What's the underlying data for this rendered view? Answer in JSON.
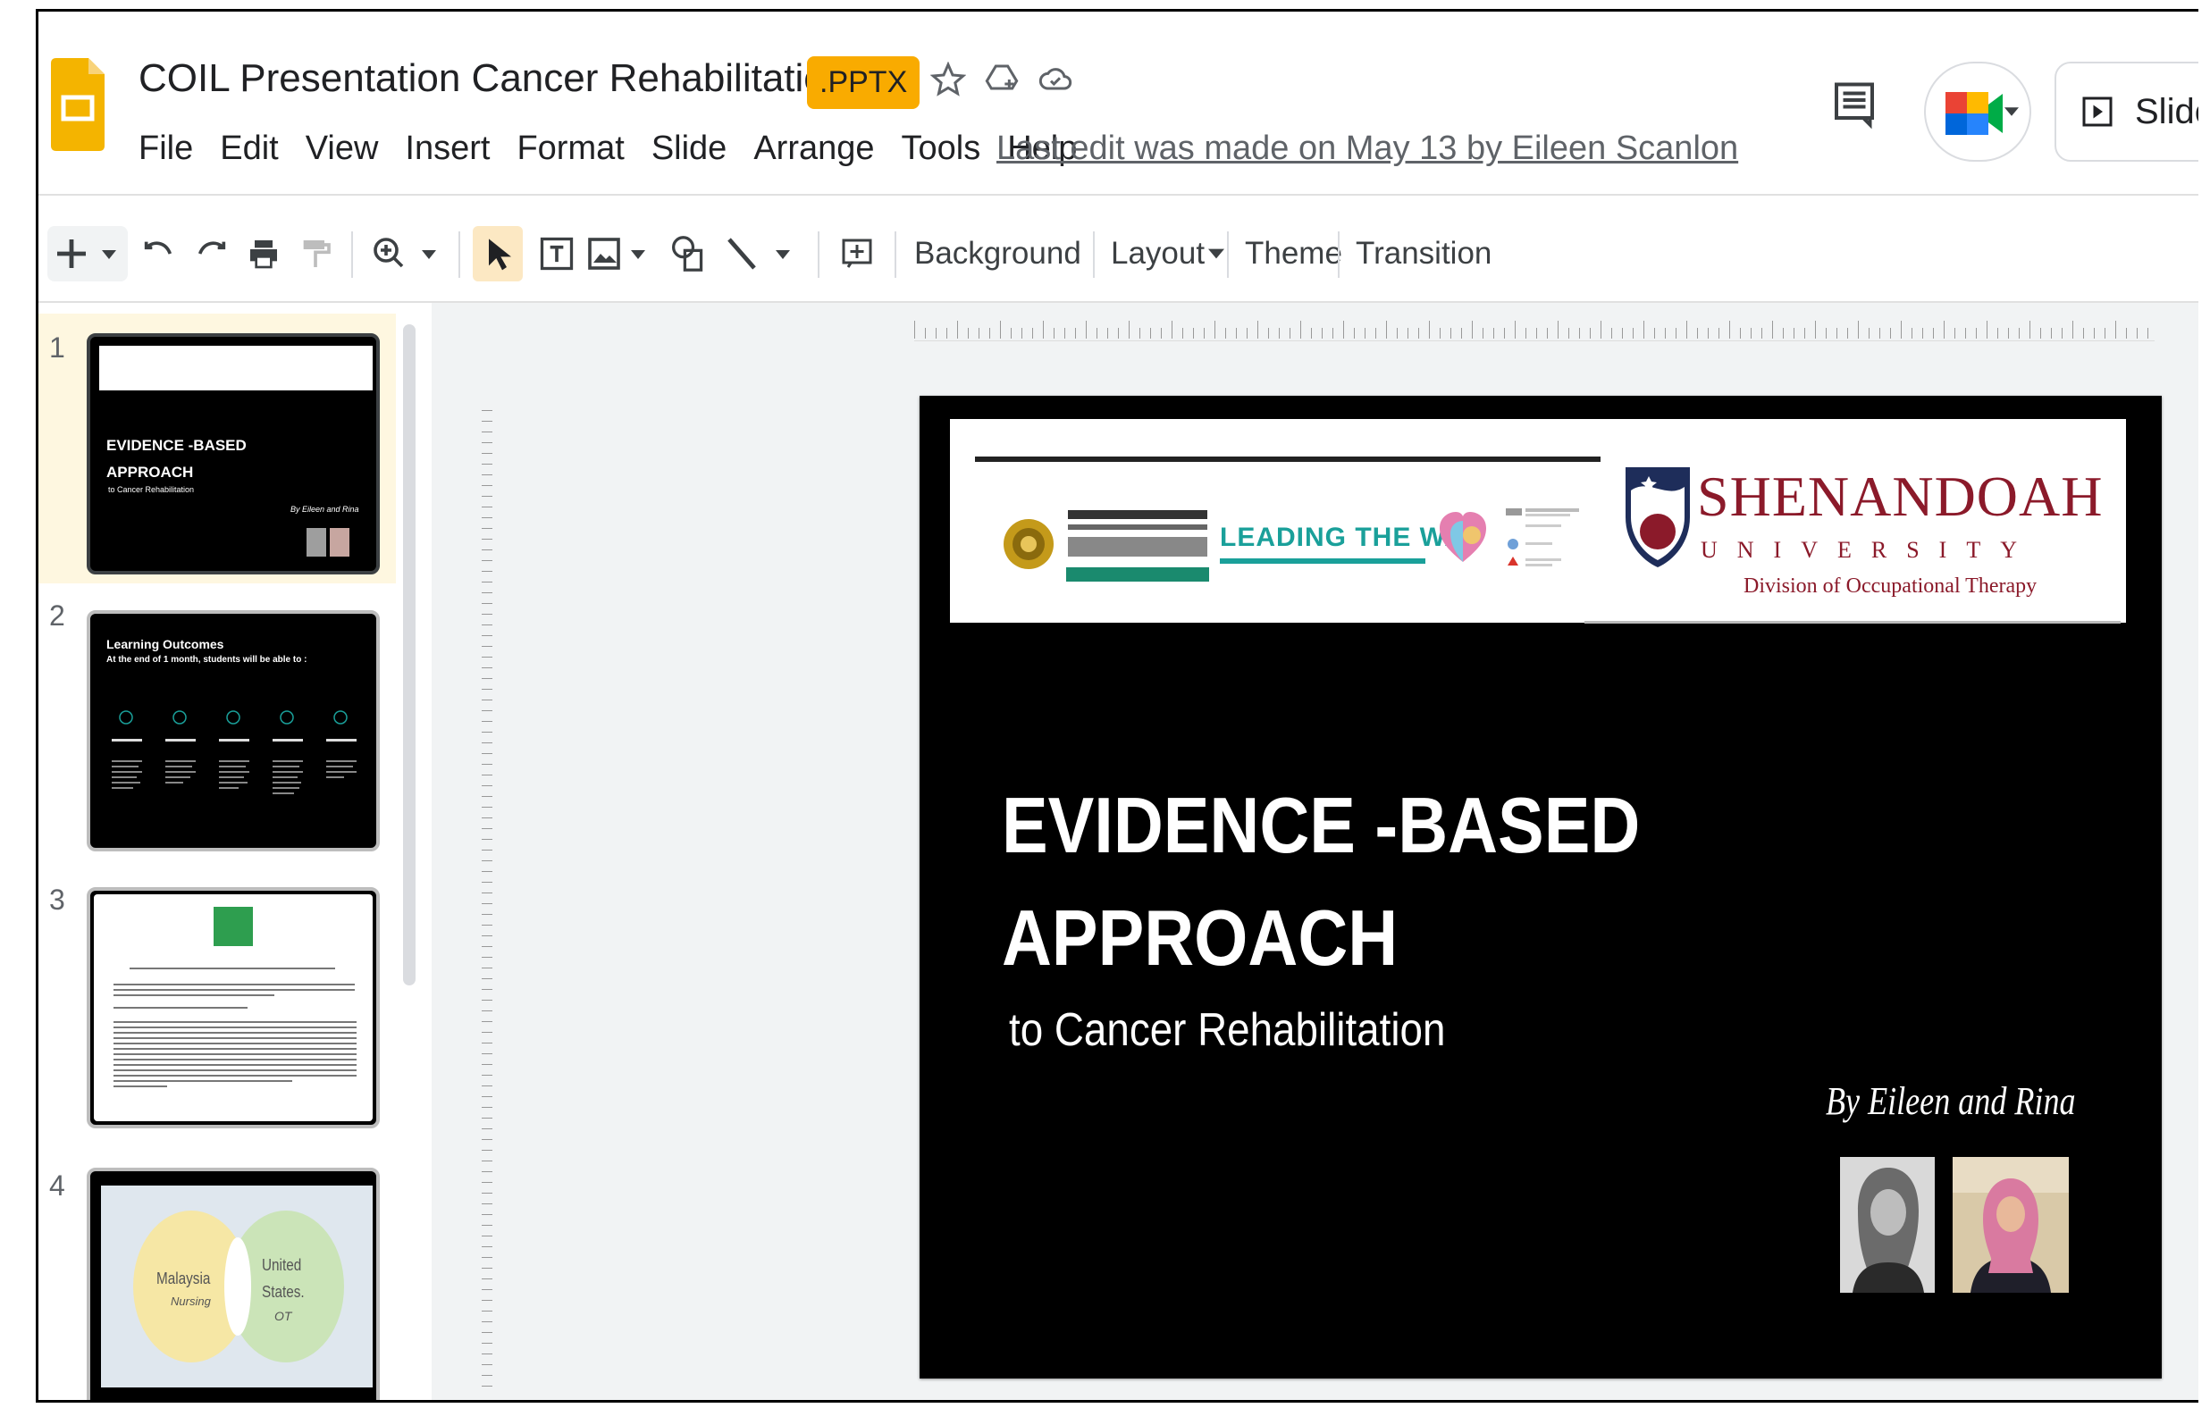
{
  "app": {
    "title": "COIL Presentation Cancer Rehabilitation",
    "file_badge": ".PPTX",
    "last_edit": "Last edit was made on May 13 by Eileen Scanlon",
    "slideshow_label": "Slide"
  },
  "menu": [
    "File",
    "Edit",
    "View",
    "Insert",
    "Format",
    "Slide",
    "Arrange",
    "Tools",
    "Help"
  ],
  "toolbar": {
    "background": "Background",
    "layout": "Layout",
    "theme": "Theme",
    "transition": "Transition"
  },
  "filmstrip": {
    "slides": [
      {
        "number": "1",
        "heading": "EVIDENCE -BASED",
        "heading2": "APPROACH",
        "sub": "to Cancer Rehabilitation",
        "by": "By Eileen and Rina"
      },
      {
        "number": "2",
        "heading": "Learning Outcomes",
        "sub": "At the end of 1 month, students will be able to :"
      },
      {
        "number": "3"
      },
      {
        "number": "4",
        "left": "Malaysia",
        "left_sub": "Nursing",
        "right": "United States.",
        "right_sub": "OT"
      }
    ]
  },
  "slide": {
    "title_line1": "EVIDENCE -BASED",
    "title_line2": "APPROACH",
    "subtitle": "to Cancer Rehabilitation",
    "byline": "By Eileen and Rina",
    "logos": {
      "leading": "LEADING THE WAY",
      "shenandoah": "SHENANDOAH",
      "university": "UNIVERSITY",
      "division": "Division of Occupational Therapy"
    }
  },
  "colors": {
    "brand_yellow": "#f4b400",
    "pptx_badge": "#f9ab00",
    "selected_slide_bg": "#fef7e0",
    "shenandoah_red": "#8b1a2a",
    "leading_teal": "#1aa09a"
  }
}
